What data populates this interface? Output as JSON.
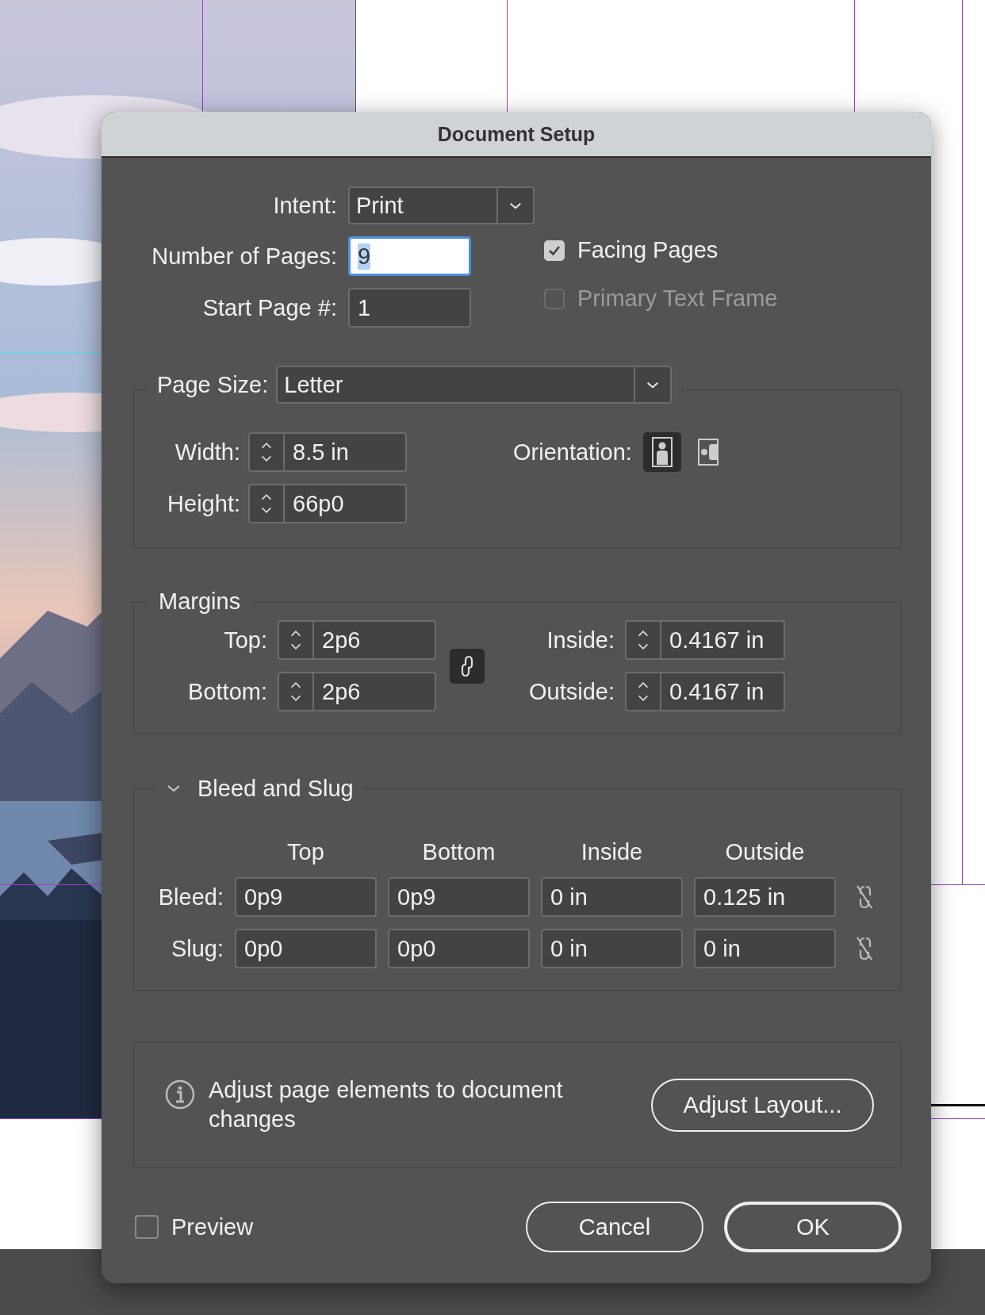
{
  "dialog": {
    "title": "Document Setup"
  },
  "intent": {
    "label": "Intent:",
    "value": "Print"
  },
  "number_of_pages": {
    "label": "Number of Pages:",
    "value": "9",
    "focused": true
  },
  "start_page": {
    "label": "Start Page #:",
    "value": "1",
    "focused": false
  },
  "options": [
    {
      "label": "Facing Pages",
      "checked": true,
      "disabled": false
    },
    {
      "label": "Primary Text Frame",
      "checked": false,
      "disabled": true
    }
  ],
  "page_size": {
    "label": "Page Size:",
    "value": "Letter",
    "width_label": "Width:",
    "width": "8.5 in",
    "height_label": "Height:",
    "height": "66p0",
    "orientation_label": "Orientation:",
    "orientations": [
      {
        "kind": "portrait",
        "selected": true
      },
      {
        "kind": "landscape",
        "selected": false
      }
    ]
  },
  "margins": {
    "title": "Margins",
    "linked": true,
    "fields": [
      {
        "label": "Top:",
        "value": "2p6"
      },
      {
        "label": "Inside:",
        "value": "0.4167 in"
      },
      {
        "label": "Bottom:",
        "value": "2p6"
      },
      {
        "label": "Outside:",
        "value": "0.4167 in"
      }
    ]
  },
  "bleed_slug": {
    "title": "Bleed and Slug",
    "expanded": true,
    "columns": [
      "Top",
      "Bottom",
      "Inside",
      "Outside"
    ],
    "rows": [
      {
        "label": "Bleed:",
        "values": [
          "0p9",
          "0p9",
          "0 in",
          "0.125 in"
        ],
        "linked": false
      },
      {
        "label": "Slug:",
        "values": [
          "0p0",
          "0p0",
          "0 in",
          "0 in"
        ],
        "linked": false
      }
    ]
  },
  "info": {
    "text": "Adjust page elements to document changes",
    "button": "Adjust Layout..."
  },
  "preview": {
    "label": "Preview",
    "checked": false
  },
  "buttons": [
    {
      "label": "Cancel",
      "kind": "secondary"
    },
    {
      "label": "OK",
      "kind": "default"
    }
  ]
}
